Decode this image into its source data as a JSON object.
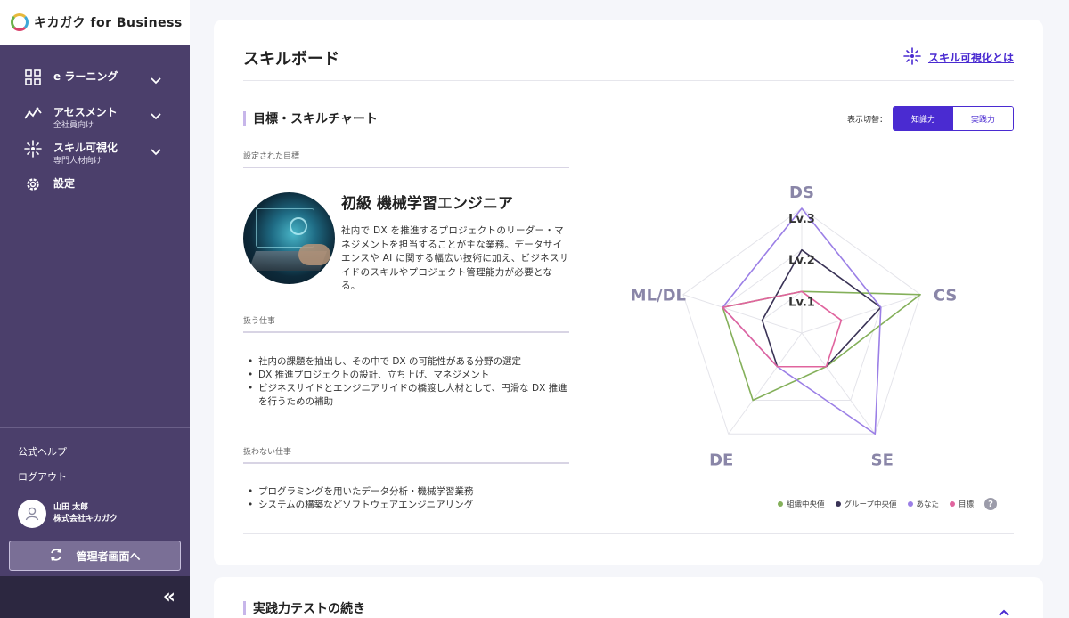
{
  "brand": {
    "name": "キカガク for Business"
  },
  "sidebar": {
    "items": [
      {
        "label": "e ラーニング",
        "sub": ""
      },
      {
        "label": "アセスメント",
        "sub": "全社員向け"
      },
      {
        "label": "スキル可視化",
        "sub": "専門人材向け"
      },
      {
        "label": "設定",
        "sub": ""
      }
    ],
    "help": "公式ヘルプ",
    "logout": "ログアウト",
    "user": {
      "name": "山田 太郎",
      "company": "株式会社キカガク"
    },
    "admin_button": "管理者画面へ",
    "collapse": "«"
  },
  "main": {
    "title": "スキルボード",
    "help_link": "スキル可視化とは",
    "section_title": "目標・スキルチャート",
    "toggle": {
      "label": "表示切替：",
      "options": [
        "知識力",
        "実践力"
      ],
      "selected": "知識力"
    },
    "goal": {
      "heading": "設定された目標",
      "name": "初級 機械学習エンジニア",
      "description": "社内で DX を推進するプロジェクトのリーダー・マネジメントを担当することが主な業務。データサイエンスや AI に関する幅広い技術に加え、ビジネスサイドのスキルやプロジェクト管理能力が必要となる。"
    },
    "tasks": {
      "heading": "扱う仕事",
      "items": [
        "社内の課題を抽出し、その中で DX の可能性がある分野の選定",
        "DX 推進プロジェクトの設計、立ち上げ、マネジメント",
        "ビジネスサイドとエンジニアサイドの橋渡し人材として、円滑な DX 推進を行うための補助"
      ]
    },
    "non_tasks": {
      "heading": "扱わない仕事",
      "items": [
        "プログラミングを用いたデータ分析・機械学習業務",
        "システムの構築などソフトウェアエンジニアリング"
      ]
    },
    "second_section_title": "実践力テストの続き"
  },
  "chart_data": {
    "type": "radar",
    "axes": [
      "DS",
      "CS",
      "SE",
      "DE",
      "ML/DL"
    ],
    "levels": [
      "Lv.1",
      "Lv.2",
      "Lv.3"
    ],
    "max": 3,
    "series": [
      {
        "name": "組織中央値",
        "color": "#84b05a",
        "values": [
          1,
          3,
          1,
          2,
          2
        ]
      },
      {
        "name": "グループ中央値",
        "color": "#3a3356",
        "values": [
          2,
          2,
          1,
          1,
          1
        ]
      },
      {
        "name": "あなた",
        "color": "#9b7fe6",
        "values": [
          3,
          2,
          3,
          1,
          2
        ]
      },
      {
        "name": "目標",
        "color": "#e0649e",
        "values": [
          1,
          1,
          1,
          1,
          2
        ]
      }
    ]
  },
  "colors": {
    "accent": "#4a2bd1",
    "sidebar": "#4b3f6b"
  }
}
